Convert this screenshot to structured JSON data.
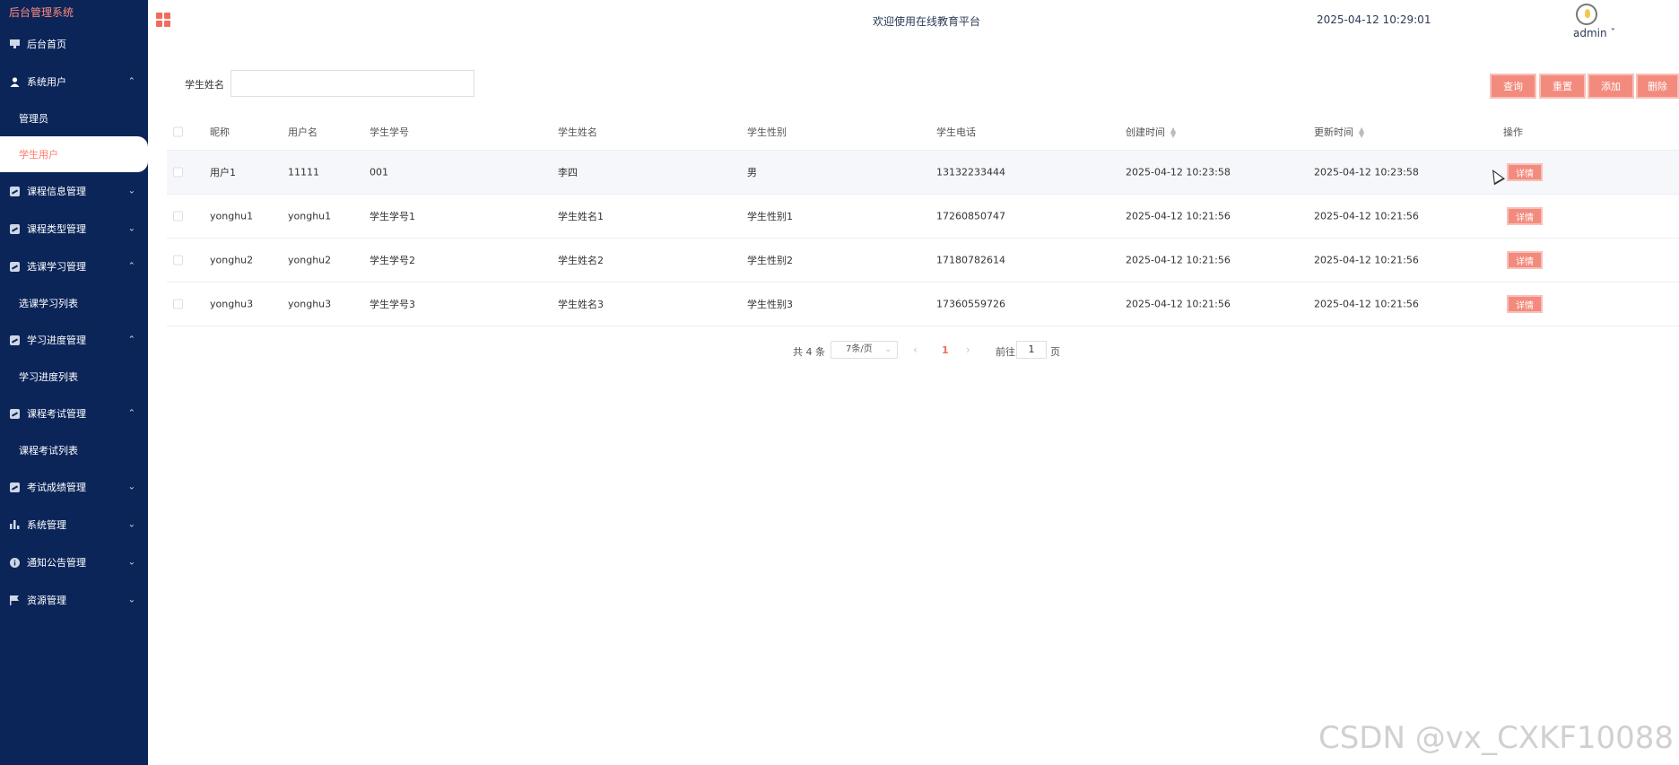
{
  "app": {
    "brand": "后台管理系统"
  },
  "header": {
    "welcome": "欢迎使用在线教育平台",
    "datetime": "2025-04-12 10:29:01",
    "user": "admin"
  },
  "sidebar": {
    "items": [
      {
        "label": "后台首页",
        "icon": "monitor-icon"
      },
      {
        "label": "系统用户",
        "icon": "user-icon",
        "arrow": "⌃"
      },
      {
        "label": "管理员",
        "sub": true
      },
      {
        "label": "学生用户",
        "sub": true,
        "active": true
      },
      {
        "label": "课程信息管理",
        "icon": "chart-icon",
        "arrow": "⌄"
      },
      {
        "label": "课程类型管理",
        "icon": "chart-icon",
        "arrow": "⌄"
      },
      {
        "label": "选课学习管理",
        "icon": "chart-icon",
        "arrow": "⌃"
      },
      {
        "label": "选课学习列表",
        "sub": true
      },
      {
        "label": "学习进度管理",
        "icon": "chart-icon",
        "arrow": "⌃"
      },
      {
        "label": "学习进度列表",
        "sub": true
      },
      {
        "label": "课程考试管理",
        "icon": "chart-icon",
        "arrow": "⌃"
      },
      {
        "label": "课程考试列表",
        "sub": true
      },
      {
        "label": "考试成绩管理",
        "icon": "chart-icon",
        "arrow": "⌄"
      },
      {
        "label": "系统管理",
        "icon": "bar-chart-icon",
        "arrow": "⌄"
      },
      {
        "label": "通知公告管理",
        "icon": "info-icon",
        "arrow": "⌄"
      },
      {
        "label": "资源管理",
        "icon": "flag-icon",
        "arrow": "⌄"
      }
    ]
  },
  "search": {
    "label": "学生姓名",
    "value": "",
    "placeholder": ""
  },
  "toolbar": {
    "query": "查询",
    "reset": "重置",
    "add": "添加",
    "delete": "删除"
  },
  "table": {
    "headers": [
      "昵称",
      "用户名",
      "学生学号",
      "学生姓名",
      "学生性别",
      "学生电话",
      "创建时间",
      "更新时间",
      "操作"
    ],
    "detail_label": "详情",
    "rows": [
      [
        "用户1",
        "11111",
        "001",
        "李四",
        "男",
        "13132233444",
        "2025-04-12 10:23:58",
        "2025-04-12 10:23:58"
      ],
      [
        "yonghu1",
        "yonghu1",
        "学生学号1",
        "学生姓名1",
        "学生性别1",
        "17260850747",
        "2025-04-12 10:21:56",
        "2025-04-12 10:21:56"
      ],
      [
        "yonghu2",
        "yonghu2",
        "学生学号2",
        "学生姓名2",
        "学生性别2",
        "17180782614",
        "2025-04-12 10:21:56",
        "2025-04-12 10:21:56"
      ],
      [
        "yonghu3",
        "yonghu3",
        "学生学号3",
        "学生姓名3",
        "学生性别3",
        "17360559726",
        "2025-04-12 10:21:56",
        "2025-04-12 10:21:56"
      ]
    ]
  },
  "pagination": {
    "total": "共 4 条",
    "page_size": "7条/页",
    "current": "1",
    "goto_label": "前往",
    "goto_value": "1",
    "page_label": "页"
  },
  "watermark": "CSDN @vx_CXKF10088",
  "colors": {
    "sidebar": "#0b2559",
    "accent": "#f28b7e",
    "brand": "#ff8a7a"
  }
}
